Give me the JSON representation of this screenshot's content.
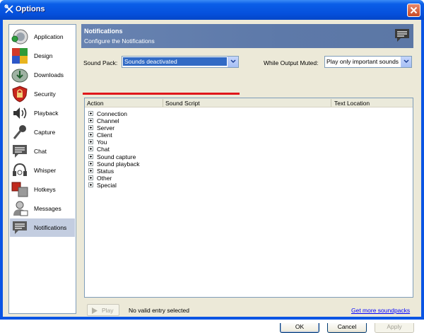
{
  "window": {
    "title": "Options"
  },
  "sidebar": {
    "items": [
      {
        "label": "Application",
        "icon": "application-icon"
      },
      {
        "label": "Design",
        "icon": "design-icon"
      },
      {
        "label": "Downloads",
        "icon": "downloads-icon"
      },
      {
        "label": "Security",
        "icon": "security-icon"
      },
      {
        "label": "Playback",
        "icon": "speaker-icon"
      },
      {
        "label": "Capture",
        "icon": "microphone-icon"
      },
      {
        "label": "Chat",
        "icon": "chat-icon"
      },
      {
        "label": "Whisper",
        "icon": "headset-icon"
      },
      {
        "label": "Hotkeys",
        "icon": "hotkeys-icon"
      },
      {
        "label": "Messages",
        "icon": "messages-icon"
      },
      {
        "label": "Notifications",
        "icon": "notifications-icon",
        "selected": true
      }
    ]
  },
  "header": {
    "title": "Notifications",
    "subtitle": "Configure the Notifications"
  },
  "sound_pack": {
    "label": "Sound Pack:",
    "value": "Sounds deactivated"
  },
  "output_muted": {
    "label": "While Output Muted:",
    "value": "Play only important sounds"
  },
  "table": {
    "columns": [
      "Action",
      "Sound Script",
      "Text Location"
    ],
    "rows": [
      "Connection",
      "Channel",
      "Server",
      "Client",
      "You",
      "Chat",
      "Sound capture",
      "Sound playback",
      "Status",
      "Other",
      "Special"
    ]
  },
  "footer": {
    "play_label": "Play",
    "status": "No valid entry selected",
    "more_link": "Get more soundpacks"
  },
  "buttons": {
    "ok": "OK",
    "cancel": "Cancel",
    "apply": "Apply"
  },
  "colors": {
    "title_bar": "#0a55e4",
    "selection": "#316ac5",
    "underline": "#e0171b",
    "header": "#6883b1"
  }
}
